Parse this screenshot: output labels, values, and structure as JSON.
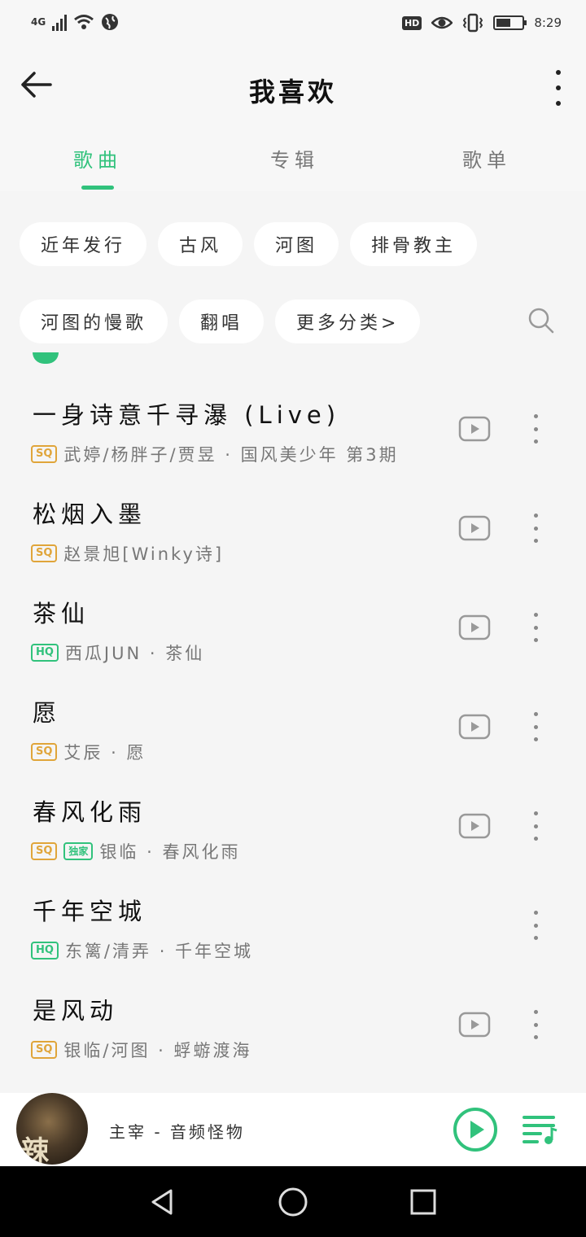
{
  "status_bar": {
    "network": "4G",
    "time": "8:29",
    "hd": "HD",
    "battery_level": 0.55
  },
  "header": {
    "title": "我喜欢"
  },
  "tabs": [
    {
      "label": "歌曲",
      "active": true
    },
    {
      "label": "专辑",
      "active": false
    },
    {
      "label": "歌单",
      "active": false
    }
  ],
  "filters": {
    "row1": [
      "近年发行",
      "古风",
      "河图",
      "排骨教主"
    ],
    "row2": [
      "河图的慢歌",
      "翻唱",
      "更多分类>"
    ]
  },
  "songs": [
    {
      "title": "一身诗意千寻瀑 (Live)",
      "quality": "SQ",
      "exclusive": "",
      "artist": "武婷/杨胖子/贾昱 · 国风美少年 第3期",
      "has_mv": true
    },
    {
      "title": "松烟入墨",
      "quality": "SQ",
      "exclusive": "",
      "artist": "赵景旭[Winky诗]",
      "has_mv": true
    },
    {
      "title": "茶仙",
      "quality": "HQ",
      "exclusive": "",
      "artist": "西瓜JUN · 茶仙",
      "has_mv": true
    },
    {
      "title": "愿",
      "quality": "SQ",
      "exclusive": "",
      "artist": "艾辰 · 愿",
      "has_mv": true
    },
    {
      "title": "春风化雨",
      "quality": "SQ",
      "exclusive": "独家",
      "artist": "银临 · 春风化雨",
      "has_mv": true
    },
    {
      "title": "千年空城",
      "quality": "HQ",
      "exclusive": "",
      "artist": "东篱/清弄 · 千年空城",
      "has_mv": false
    },
    {
      "title": "是风动",
      "quality": "SQ",
      "exclusive": "",
      "artist": "银临/河图 · 蜉蝣渡海",
      "has_mv": true
    }
  ],
  "player": {
    "now_playing": "主宰 - 音频怪物",
    "album_glyph": "辣"
  },
  "colors": {
    "accent": "#31c27c",
    "sq": "#e0a53a",
    "background": "#f5f5f5"
  },
  "icons": [
    "back-arrow-icon",
    "more-vertical-icon",
    "search-icon",
    "mv-play-icon",
    "play-circle-icon",
    "playlist-queue-icon",
    "nav-back-icon",
    "nav-home-icon",
    "nav-recents-icon"
  ]
}
